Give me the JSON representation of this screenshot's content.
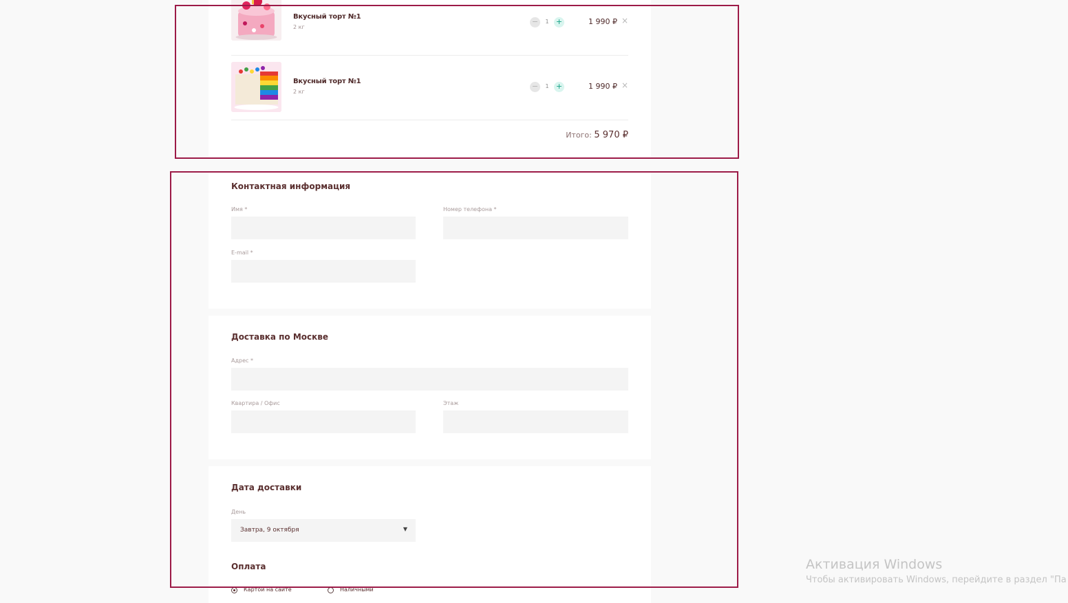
{
  "cart": {
    "items": [
      {
        "name": "Вкусный торт №1",
        "weight": "2 кг",
        "quantity": "1",
        "price": "1 990 ₽",
        "minus_glyph": "−",
        "plus_glyph": "+",
        "remove_glyph": "×"
      },
      {
        "name": "Вкусный торт №1",
        "weight": "2 кг",
        "quantity": "1",
        "price": "1 990 ₽",
        "minus_glyph": "−",
        "plus_glyph": "+",
        "remove_glyph": "×"
      }
    ],
    "total_label": "Итого:",
    "total_value": "5 970 ₽"
  },
  "contact": {
    "title": "Контактная информация",
    "name_label": "Имя *",
    "phone_label": "Номер телефона *",
    "email_label": "E-mail *"
  },
  "delivery": {
    "title": "Доставка по Москве",
    "address_label": "Адрес *",
    "apartment_label": "Квартира / Офис",
    "floor_label": "Этаж"
  },
  "delivery_date": {
    "title": "Дата доставки",
    "day_label": "День",
    "day_value": "Завтра, 9 октября",
    "arrow_glyph": "▼"
  },
  "payment": {
    "title": "Оплата",
    "options": [
      {
        "label": "Картой на сайте",
        "checked": true
      },
      {
        "label": "Наличными",
        "checked": false
      }
    ]
  },
  "watermark": {
    "title": "Активация Windows",
    "text": "Чтобы активировать Windows, перейдите в раздел \"Па"
  },
  "colors": {
    "highlight": "#9c1a47",
    "accent_plus": "#16a085",
    "text_primary": "#5a2f2f"
  }
}
